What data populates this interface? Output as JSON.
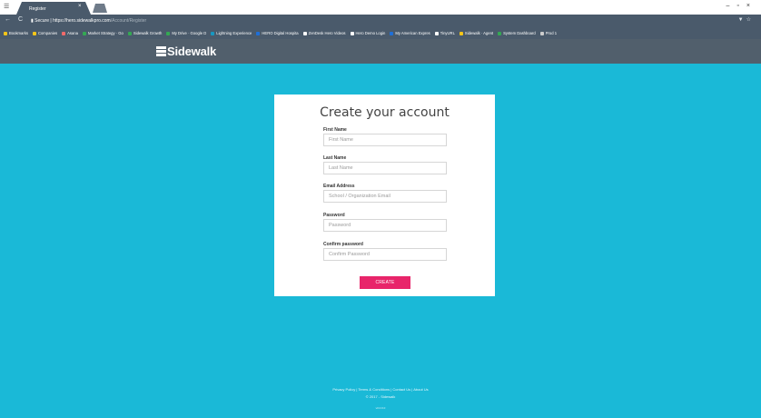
{
  "browser": {
    "tab_title": "Register",
    "tab_close": "×",
    "address": {
      "secure_label": "Secure",
      "origin": "https://hero.sidewalkpro.com",
      "path": "/Account/Register"
    },
    "bookmarks": [
      {
        "label": "Bookmarks",
        "color": "#f5c518"
      },
      {
        "label": "Companies",
        "color": "#f5c518"
      },
      {
        "label": "Asana",
        "color": "#f06a6a"
      },
      {
        "label": "Market Strategy · Go",
        "color": "#34a853"
      },
      {
        "label": "Sidewalk Growth",
        "color": "#34a853"
      },
      {
        "label": "My Drive · Google D",
        "color": "#34a853"
      },
      {
        "label": "Lightning Experience",
        "color": "#1798c1"
      },
      {
        "label": "HERO Digital Hospita",
        "color": "#1e6fd9"
      },
      {
        "label": "ZenDesk Hero Videos",
        "color": "#ffffff"
      },
      {
        "label": "Hero Demo Login",
        "color": "#ffffff"
      },
      {
        "label": "My American Expres",
        "color": "#1e6fd9"
      },
      {
        "label": "TinyURL",
        "color": "#ffffff"
      },
      {
        "label": "Sidewalk · Agent",
        "color": "#f5c518"
      },
      {
        "label": "System Dashboard",
        "color": "#34a853"
      },
      {
        "label": "Prod 1",
        "color": "#cccccc"
      }
    ]
  },
  "header": {
    "brand": "Sidewalk"
  },
  "form": {
    "title": "Create your account",
    "fields": [
      {
        "label": "First Name",
        "placeholder": "First Name"
      },
      {
        "label": "Last Name",
        "placeholder": "Last Name"
      },
      {
        "label": "Email Address",
        "placeholder": "School / Organization Email"
      },
      {
        "label": "Password",
        "placeholder": "Password"
      },
      {
        "label": "Confirm password",
        "placeholder": "Confirm Password"
      }
    ],
    "submit_label": "CREATE"
  },
  "footer": {
    "links": [
      "Privacy Policy",
      "Terms & Conditions",
      "Contact Us",
      "About Us"
    ],
    "separator": " | ",
    "copyright": "© 2017 - Sidewalk",
    "version": "v0.0.0.0"
  },
  "colors": {
    "page_bg": "#1ab9d7",
    "header_bg": "#515f6c",
    "accent": "#e8256a"
  }
}
